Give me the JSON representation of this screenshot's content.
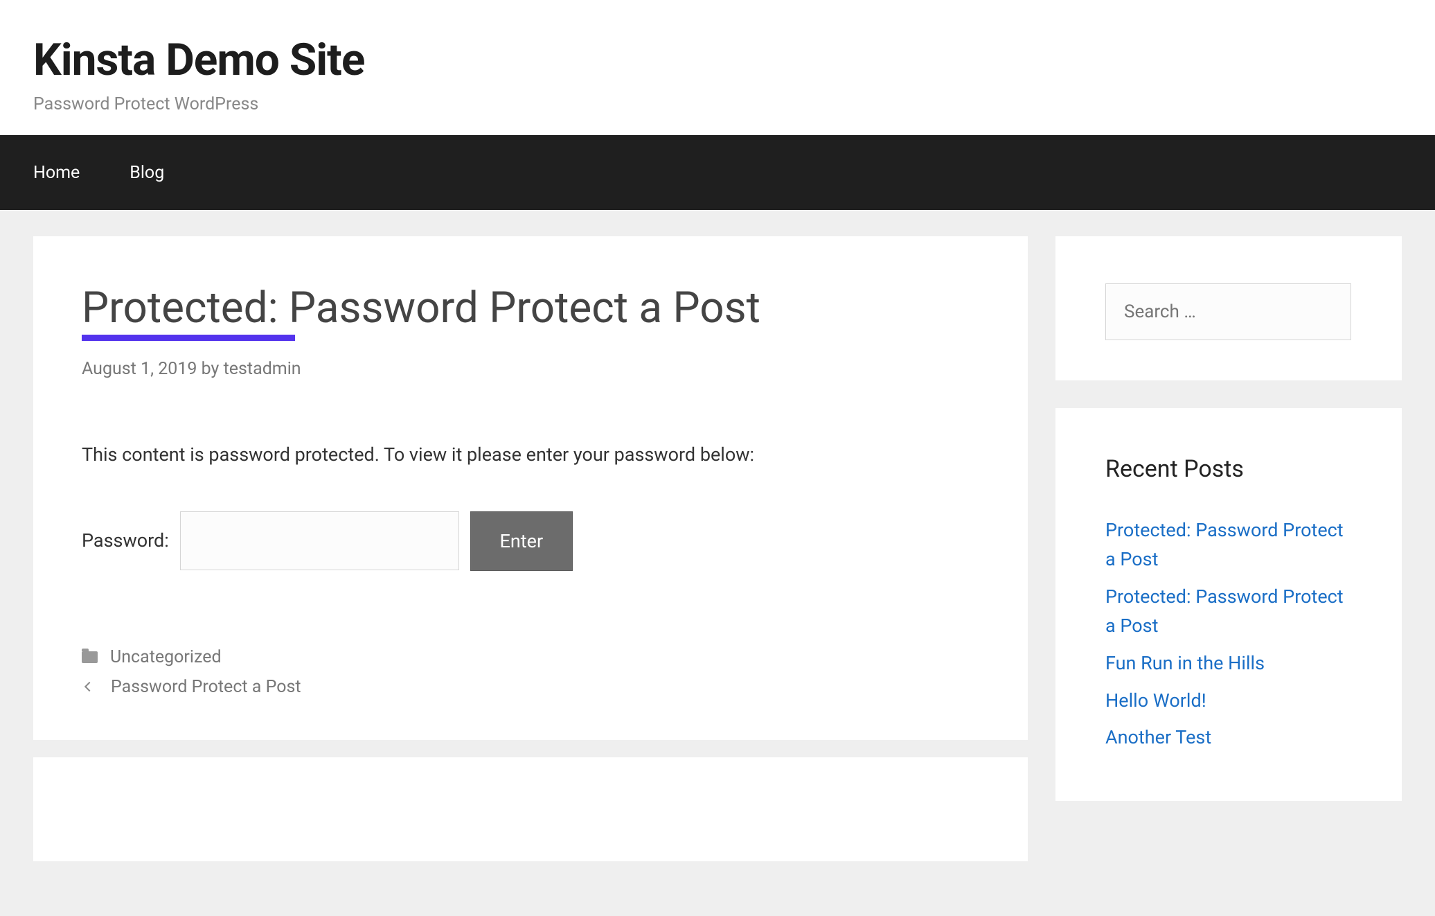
{
  "header": {
    "site_title": "Kinsta Demo Site",
    "tagline": "Password Protect WordPress"
  },
  "nav": {
    "items": [
      {
        "label": "Home"
      },
      {
        "label": "Blog"
      }
    ]
  },
  "post": {
    "title": "Protected: Password Protect a Post",
    "date": "August 1, 2019",
    "by_label": "by",
    "author": "testadmin",
    "content_text": "This content is password protected. To view it please enter your password below:",
    "password_label": "Password:",
    "enter_button": "Enter",
    "category": "Uncategorized",
    "prev_post": "Password Protect a Post"
  },
  "sidebar": {
    "search_placeholder": "Search …",
    "recent_title": "Recent Posts",
    "recent": [
      "Protected: Password Protect a Post",
      "Protected: Password Protect a Post",
      "Fun Run in the Hills",
      "Hello World!",
      "Another Test"
    ]
  },
  "colors": {
    "accent_underline": "#5333ed",
    "nav_bg": "#1f1f1f",
    "body_bg": "#efefef",
    "link": "#1a6ec6",
    "button_bg": "#6c6c6c"
  }
}
